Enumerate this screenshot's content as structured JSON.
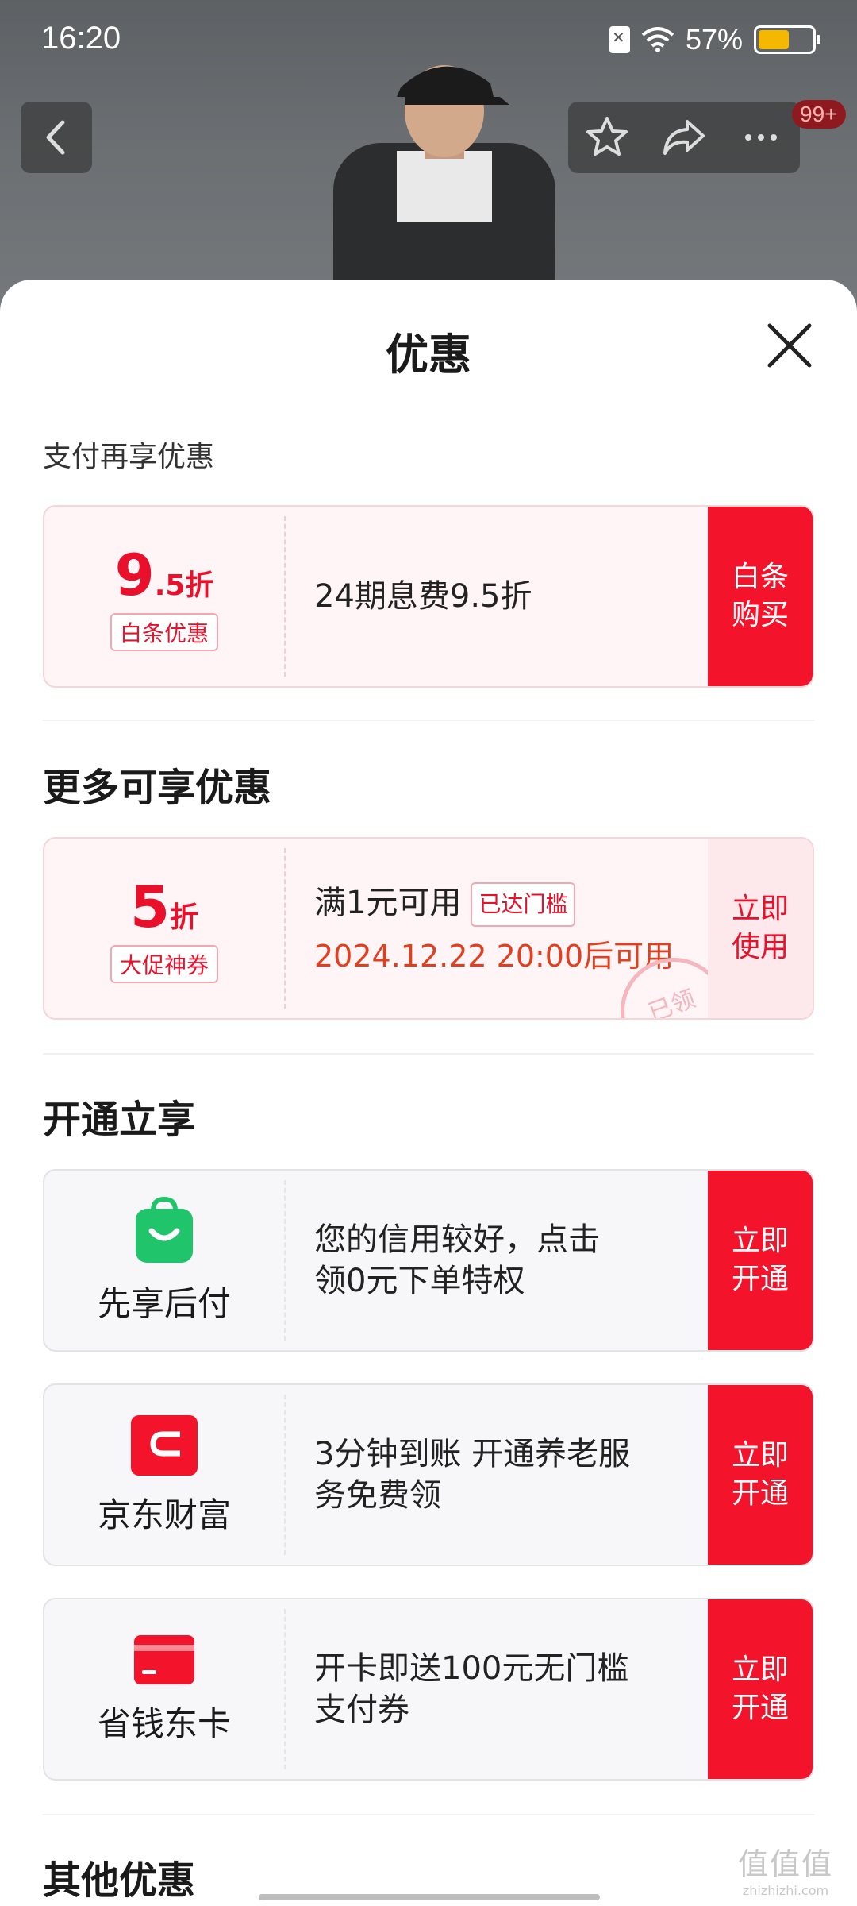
{
  "status": {
    "time": "16:20",
    "battery": "57%",
    "battery_level": 0.57
  },
  "header": {
    "badge": "99+"
  },
  "sheet": {
    "title": "优惠"
  },
  "pay_section": {
    "label": "支付再享优惠",
    "card": {
      "discount_main": "9",
      "discount_sub": ".5折",
      "tag": "白条优惠",
      "desc": "24期息费9.5折",
      "button": [
        "白条",
        "购买"
      ]
    }
  },
  "more_section": {
    "heading": "更多可享优惠",
    "card": {
      "discount_main": "5",
      "discount_sub": "折",
      "tag": "大促神券",
      "desc": "满1元可用",
      "reached": "已达门槛",
      "time_note": "2024.12.22 20:00后可用",
      "stamp": "已领",
      "button": [
        "立即",
        "使用"
      ]
    }
  },
  "open_section": {
    "heading": "开通立享",
    "items": [
      {
        "name": "先享后付",
        "desc": [
          "您的信用较好，点击",
          "领0元下单特权"
        ],
        "button": [
          "立即",
          "开通"
        ],
        "icon": "shopping-bag-icon",
        "color": "#1fc46b"
      },
      {
        "name": "京东财富",
        "desc": [
          "3分钟到账 开通养老服",
          "务免费领"
        ],
        "button": [
          "立即",
          "开通"
        ],
        "icon": "wallet-icon",
        "color": "#f3142c"
      },
      {
        "name": "省钱东卡",
        "desc": [
          "开卡即送100元无门槛",
          "支付券"
        ],
        "button": [
          "立即",
          "开通"
        ],
        "icon": "card-icon",
        "color": "#f3142c"
      }
    ]
  },
  "other_section": {
    "heading": "其他优惠"
  },
  "watermark": {
    "top": "值值值",
    "bottom": "zhizhizhi.com"
  }
}
